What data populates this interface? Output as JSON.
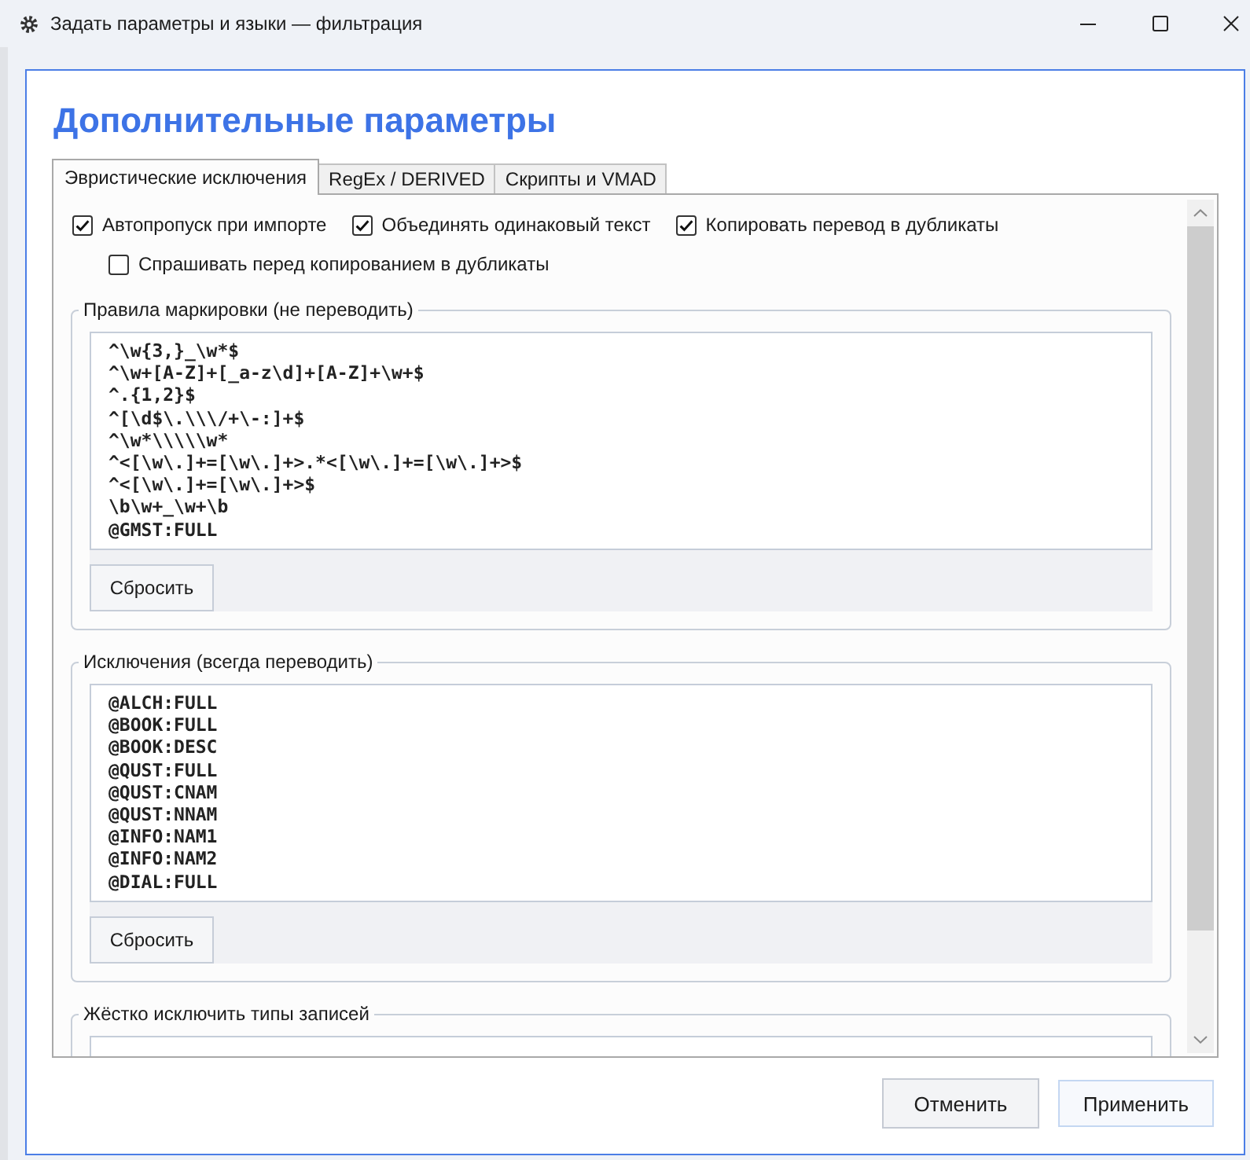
{
  "window": {
    "title": "Задать параметры и языки — фильтрация"
  },
  "heading": "Дополнительные параметры",
  "tabs": [
    {
      "label": "Эвристические исключения",
      "selected": true
    },
    {
      "label": "RegEx / DERIVED",
      "selected": false
    },
    {
      "label": "Скрипты и VMAD",
      "selected": false
    }
  ],
  "option_rows": [
    [
      {
        "label": "Автопропуск при импорте",
        "checked": true
      },
      {
        "label": "Объединять одинаковый текст",
        "checked": true
      },
      {
        "label": "Копировать перевод в дубликаты",
        "checked": true
      }
    ],
    [
      {
        "label": "Спрашивать перед копированием в дубликаты",
        "checked": false
      }
    ]
  ],
  "groups": [
    {
      "legend": "Правила маркировки (не переводить)",
      "lines": [
        "^\\w{3,}_\\w*$",
        "^\\w+[A-Z]+[_a-z\\d]+[A-Z]+\\w+$",
        "^.{1,2}$",
        "^[\\d$\\.\\\\\\/+\\-:]+$",
        "^\\w*\\\\\\\\\\w*",
        "^<[\\w\\.]+=[\\w\\.]+>.*<[\\w\\.]+=[\\w\\.]+>$",
        "^<[\\w\\.]+=[\\w\\.]+>$",
        "\\b\\w+_\\w+\\b",
        "@GMST:FULL"
      ],
      "button": "Сбросить"
    },
    {
      "legend": "Исключения (всегда переводить)",
      "lines": [
        "@ALCH:FULL",
        "@BOOK:FULL",
        "@BOOK:DESC",
        "@QUST:FULL",
        "@QUST:CNAM",
        "@QUST:NNAM",
        "@INFO:NAM1",
        "@INFO:NAM2",
        "@DIAL:FULL"
      ],
      "button": "Сбросить"
    },
    {
      "legend": "Жёстко исключить типы записей"
    }
  ],
  "buttons": [
    {
      "label": "Отменить",
      "default": false
    },
    {
      "label": "Применить",
      "default": true
    }
  ]
}
